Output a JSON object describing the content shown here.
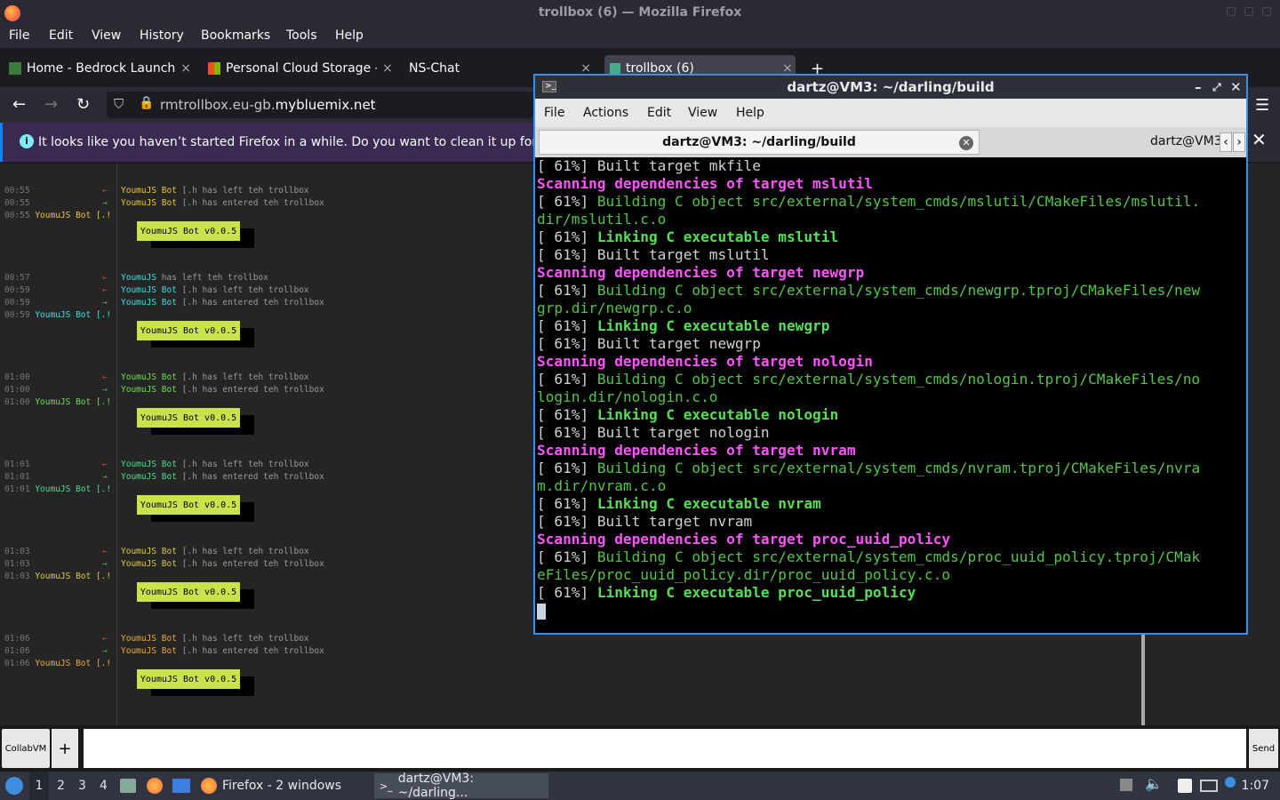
{
  "window_title": "trollbox (6) — Mozilla Firefox",
  "menubar": [
    "File",
    "Edit",
    "View",
    "History",
    "Bookmarks",
    "Tools",
    "Help"
  ],
  "tabs": [
    {
      "label": "Home - Bedrock Launche",
      "close": "×"
    },
    {
      "label": "Personal Cloud Storage -",
      "close": "×"
    },
    {
      "label": "NS-Chat",
      "close": "×"
    },
    {
      "label": "trollbox (6)",
      "close": "×"
    }
  ],
  "new_tab": "+",
  "url": {
    "prefix": "rmtrollbox.eu-gb.",
    "domain": "mybluemix.net"
  },
  "notification": "It looks like you haven’t started Firefox in a while. Do you want to clean it up for a f",
  "chat": {
    "blocks": [
      {
        "times": [
          "00:55",
          "00:55",
          "00:55"
        ],
        "left": {
          "name": "YoumuJS Bot",
          "rest": "[.h has left teh trollbox"
        },
        "entered": {
          "name": "YoumuJS Bot",
          "rest": "[.h has entered teh trollbox"
        },
        "speaker": "YoumuJS Bot [.!",
        "bot": "YoumuJS Bot v0.0.5",
        "color": "#f0c43a"
      },
      {
        "times": [
          "00:57",
          "00:59",
          "00:59",
          "00:59"
        ],
        "extra": {
          "name": "YoumuJS",
          "rest": "has left teh trollbox"
        },
        "left": {
          "name": "YoumuJS Bot",
          "rest": "[.h has left teh trollbox"
        },
        "entered": {
          "name": "YoumuJS Bot",
          "rest": "[.h has entered teh trollbox"
        },
        "speaker": "YoumuJS Bot [.!",
        "bot": "YoumuJS Bot v0.0.5",
        "color": "#3ae0e0"
      },
      {
        "times": [
          "01:00",
          "01:00",
          "01:00"
        ],
        "left": {
          "name": "YoumuJS Bot",
          "rest": "[.h has left teh trollbox"
        },
        "entered": {
          "name": "YoumuJS Bot",
          "rest": "[.h has entered teh trollbox"
        },
        "speaker": "YoumuJS Bot [.!",
        "bot": "YoumuJS Bot v0.0.5",
        "color": "#6ce04a"
      },
      {
        "times": [
          "01:01",
          "01:01",
          "01:01"
        ],
        "left": {
          "name": "YoumuJS Bot",
          "rest": "[.h has left teh trollbox"
        },
        "entered": {
          "name": "YoumuJS Bot",
          "rest": "[.h has entered teh trollbox"
        },
        "speaker": "YoumuJS Bot [.!",
        "bot": "YoumuJS Bot v0.0.5",
        "color": "#4ae08a"
      },
      {
        "times": [
          "01:03",
          "01:03",
          "01:03"
        ],
        "left": {
          "name": "YoumuJS Bot",
          "rest": "[.h has left teh trollbox"
        },
        "entered": {
          "name": "YoumuJS Bot",
          "rest": "[.h has entered teh trollbox"
        },
        "speaker": "YoumuJS Bot [.!",
        "bot": "YoumuJS Bot v0.0.5",
        "color": "#e0c84a"
      },
      {
        "times": [
          "01:06",
          "01:06",
          "01:06"
        ],
        "left": {
          "name": "YoumuJS Bot",
          "rest": "[.h has left teh trollbox"
        },
        "entered": {
          "name": "YoumuJS Bot",
          "rest": "[.h has entered teh trollbox"
        },
        "speaker": "YoumuJS Bot [.!",
        "bot": "YoumuJS Bot v0.0.5",
        "color": "#f0a83a"
      }
    ]
  },
  "input": {
    "collab": "CollabVM",
    "plus": "+",
    "send": "Send"
  },
  "terminal": {
    "title": "dartz@VM3: ~/darling/build",
    "menu": [
      "File",
      "Actions",
      "Edit",
      "View",
      "Help"
    ],
    "tab_active": "dartz@VM3: ~/darling/build",
    "tab_other": "dartz@VM3:",
    "lines": [
      [
        [
          "",
          "[ 61%] Built target mkfile"
        ]
      ],
      [
        [
          "m",
          "Scanning dependencies of target mslutil"
        ]
      ],
      [
        [
          "",
          "[ 61%] "
        ],
        [
          "g",
          "Building C object src/external/system_cmds/mslutil/CMakeFiles/mslutil."
        ]
      ],
      [
        [
          "g",
          "dir/mslutil.c.o"
        ]
      ],
      [
        [
          "",
          "[ 61%] "
        ],
        [
          "gb",
          "Linking C executable mslutil"
        ]
      ],
      [
        [
          "",
          "[ 61%] Built target mslutil"
        ]
      ],
      [
        [
          "m",
          "Scanning dependencies of target newgrp"
        ]
      ],
      [
        [
          "",
          "[ 61%] "
        ],
        [
          "g",
          "Building C object src/external/system_cmds/newgrp.tproj/CMakeFiles/new"
        ]
      ],
      [
        [
          "g",
          "grp.dir/newgrp.c.o"
        ]
      ],
      [
        [
          "",
          "[ 61%] "
        ],
        [
          "gb",
          "Linking C executable newgrp"
        ]
      ],
      [
        [
          "",
          "[ 61%] Built target newgrp"
        ]
      ],
      [
        [
          "m",
          "Scanning dependencies of target nologin"
        ]
      ],
      [
        [
          "",
          "[ 61%] "
        ],
        [
          "g",
          "Building C object src/external/system_cmds/nologin.tproj/CMakeFiles/no"
        ]
      ],
      [
        [
          "g",
          "login.dir/nologin.c.o"
        ]
      ],
      [
        [
          "",
          "[ 61%] "
        ],
        [
          "gb",
          "Linking C executable nologin"
        ]
      ],
      [
        [
          "",
          "[ 61%] Built target nologin"
        ]
      ],
      [
        [
          "m",
          "Scanning dependencies of target nvram"
        ]
      ],
      [
        [
          "",
          "[ 61%] "
        ],
        [
          "g",
          "Building C object src/external/system_cmds/nvram.tproj/CMakeFiles/nvra"
        ]
      ],
      [
        [
          "g",
          "m.dir/nvram.c.o"
        ]
      ],
      [
        [
          "",
          "[ 61%] "
        ],
        [
          "gb",
          "Linking C executable nvram"
        ]
      ],
      [
        [
          "",
          "[ 61%] Built target nvram"
        ]
      ],
      [
        [
          "m",
          "Scanning dependencies of target proc_uuid_policy"
        ]
      ],
      [
        [
          "",
          "[ 61%] "
        ],
        [
          "g",
          "Building C object src/external/system_cmds/proc_uuid_policy.tproj/CMak"
        ]
      ],
      [
        [
          "g",
          "eFiles/proc_uuid_policy.dir/proc_uuid_policy.c.o"
        ]
      ],
      [
        [
          "",
          "[ 61%] "
        ],
        [
          "gb",
          "Linking C executable proc_uuid_policy"
        ]
      ]
    ]
  },
  "taskbar": {
    "workspaces": [
      "1",
      "2",
      "3",
      "4"
    ],
    "firefox_task": "Firefox - 2 windows",
    "terminal_task": "dartz@VM3: ~/darling...",
    "clock": "1:07"
  }
}
